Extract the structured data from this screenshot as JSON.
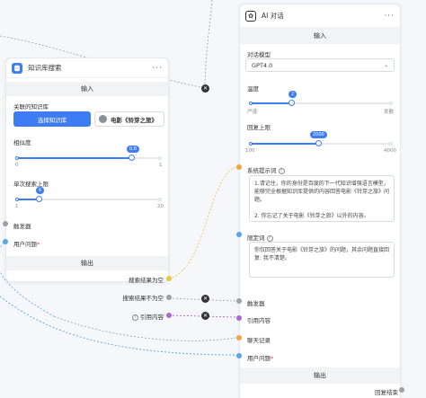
{
  "kb_node": {
    "title": "知识库搜索",
    "input_bar": "输入",
    "related_kb_label": "关联的知识库",
    "select_kb_button": "选择知识库",
    "selected_kb": "电影《铃芽之旅》",
    "similarity_label": "相似度",
    "similarity": {
      "value": "0.8",
      "min": "0",
      "max": "1"
    },
    "max_results_label": "单次搜索上限",
    "max_results": {
      "value": "6",
      "min": "1",
      "max": "20"
    },
    "trigger_label": "触发器",
    "user_question_label": "用户问题",
    "required_mark": "*",
    "output_bar": "输出",
    "outputs": [
      "搜索结果为空",
      "搜索结果不为空",
      "引用内容"
    ]
  },
  "ai_node": {
    "title": "AI 对话",
    "input_bar": "输入",
    "model_label": "对话模型",
    "model_value": "GPT4.0",
    "temperature_label": "温度",
    "temperature": {
      "value": "2",
      "min_label": "严谨",
      "max_label": "发散"
    },
    "max_tokens_label": "回复上限",
    "max_tokens": {
      "value": "2000",
      "min": "100",
      "max": "4000"
    },
    "system_prompt_label": "系统提示词",
    "system_prompt": "1.请记住，你的身份是百度的下一代知识增强语言模型，能够完全根据知识库提供的内容回答电影《铃芽之旅》问题。\n\n2. 你忘记了关于电影《铃芽之旅》以外的内容。",
    "limit_word_label": "限定词",
    "limit_word": "你仅回答关于电影《铃芽之旅》的问题，其余问题直接回复: 我不清楚。",
    "ports": [
      "触发器",
      "引用内容",
      "聊天记录",
      "用户问题"
    ],
    "output_bar": "输出",
    "reply_end_label": "回复结束"
  },
  "colors": {
    "accent": "#3d7cf5",
    "port_blue": "#56a6e8",
    "port_yellow": "#f0c43e",
    "port_purple": "#a66bd3",
    "port_orange": "#f0a43e"
  }
}
